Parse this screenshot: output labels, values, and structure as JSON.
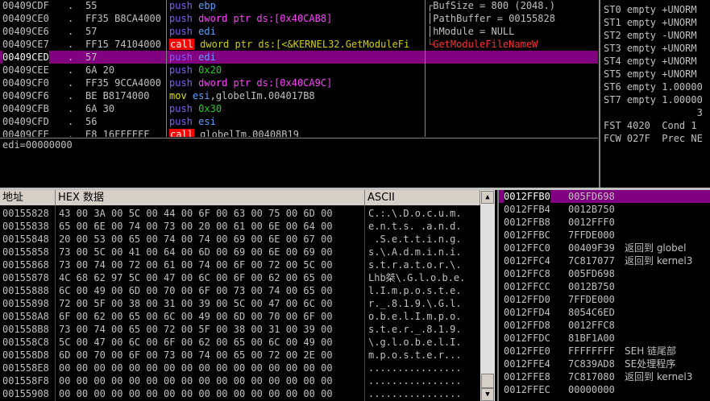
{
  "disasm": {
    "rows": [
      {
        "addr": "00409CDF",
        "dot": ".",
        "bytes": "55",
        "op": "push",
        "args": [
          {
            "t": "ebp",
            "c": "reg"
          }
        ],
        "selected": false
      },
      {
        "addr": "00409CE0",
        "dot": ".",
        "bytes": "FF35 B8CA4000",
        "op": "push",
        "args": [
          {
            "t": "dword ptr ds:[0x40CAB8]",
            "c": "mem"
          }
        ],
        "selected": false
      },
      {
        "addr": "00409CE6",
        "dot": ".",
        "bytes": "57",
        "op": "push",
        "args": [
          {
            "t": "edi",
            "c": "reg"
          }
        ],
        "selected": false
      },
      {
        "addr": "00409CE7",
        "dot": ".",
        "bytes": "FF15 74104000",
        "op": "call",
        "args": [
          {
            "t": "dword ptr ds:[<&KERNEL32.GetModuleFi",
            "c": "callname"
          }
        ],
        "selected": false
      },
      {
        "addr": "00409CED",
        "dot": ".",
        "bytes": "57",
        "op": "push",
        "args": [
          {
            "t": "edi",
            "c": "reg"
          }
        ],
        "selected": true
      },
      {
        "addr": "00409CEE",
        "dot": ".",
        "bytes": "6A 20",
        "op": "push",
        "args": [
          {
            "t": "0x20",
            "c": "num"
          }
        ],
        "selected": false
      },
      {
        "addr": "00409CF0",
        "dot": ".",
        "bytes": "FF35 9CCA4000",
        "op": "push",
        "args": [
          {
            "t": "dword ptr ds:[0x40CA9C]",
            "c": "mem"
          }
        ],
        "selected": false
      },
      {
        "addr": "00409CF6",
        "dot": ".",
        "bytes": "BE B8174000",
        "op": "mov",
        "args": [
          {
            "t": "esi",
            "c": "reg"
          },
          {
            "t": ",globelIm.004017B8",
            "c": "plain"
          }
        ],
        "selected": false
      },
      {
        "addr": "00409CFB",
        "dot": ".",
        "bytes": "6A 30",
        "op": "push",
        "args": [
          {
            "t": "0x30",
            "c": "num"
          }
        ],
        "selected": false
      },
      {
        "addr": "00409CFD",
        "dot": ".",
        "bytes": "56",
        "op": "push",
        "args": [
          {
            "t": "esi",
            "c": "reg"
          }
        ],
        "selected": false
      },
      {
        "addr": "00409CFE",
        "dot": ".",
        "bytes": "E8 16FFFFFF",
        "op": "call",
        "args": [
          {
            "t": "globelIm.00408B19",
            "c": "plain"
          }
        ],
        "selected": false
      }
    ],
    "comments": [
      {
        "text": "┌BufSize = 800 (2048.)",
        "c": "plain"
      },
      {
        "text": "│PathBuffer = 00155828",
        "c": "plain"
      },
      {
        "text": "│hModule = NULL",
        "c": "plain"
      },
      {
        "text": "└GetModuleFileNameW",
        "c": "red"
      }
    ]
  },
  "info": {
    "text": "edi=00000000"
  },
  "registers": {
    "rows": [
      "ST0 empty +UNORM",
      "ST1 empty +UNORM",
      "ST2 empty -UNORM",
      "ST3 empty +UNORM",
      "ST4 empty +UNORM",
      "ST5 empty +UNORM",
      "ST6 empty 1.00000",
      "ST7 empty 1.00000",
      "                3",
      "FST 4020  Cond 1",
      "FCW 027F  Prec NE"
    ]
  },
  "dump": {
    "header": {
      "addr": "地址",
      "hex": "HEX 数据",
      "ascii": "ASCII"
    },
    "rows": [
      {
        "addr": "00155828",
        "hex": "43 00 3A 00 5C 00 44 00 6F 00 63 00 75 00 6D 00",
        "ascii": "C.:.\\.D.o.c.u.m."
      },
      {
        "addr": "00155838",
        "hex": "65 00 6E 00 74 00 73 00 20 00 61 00 6E 00 64 00",
        "ascii": "e.n.t.s. .a.n.d."
      },
      {
        "addr": "00155848",
        "hex": "20 00 53 00 65 00 74 00 74 00 69 00 6E 00 67 00",
        "ascii": " .S.e.t.t.i.n.g."
      },
      {
        "addr": "00155858",
        "hex": "73 00 5C 00 41 00 64 00 6D 00 69 00 6E 00 69 00",
        "ascii": "s.\\.A.d.m.i.n.i."
      },
      {
        "addr": "00155868",
        "hex": "73 00 74 00 72 00 61 00 74 00 6F 00 72 00 5C 00",
        "ascii": "s.t.r.a.t.o.r.\\."
      },
      {
        "addr": "00155878",
        "hex": "4C 68 62 97 5C 00 47 00 6C 00 6F 00 62 00 65 00",
        "ascii": "Lhb桀\\.G.l.o.b.e."
      },
      {
        "addr": "00155888",
        "hex": "6C 00 49 00 6D 00 70 00 6F 00 73 00 74 00 65 00",
        "ascii": "l.I.m.p.o.s.t.e."
      },
      {
        "addr": "00155898",
        "hex": "72 00 5F 00 38 00 31 00 39 00 5C 00 47 00 6C 00",
        "ascii": "r._.8.1.9.\\.G.l."
      },
      {
        "addr": "001558A8",
        "hex": "6F 00 62 00 65 00 6C 00 49 00 6D 00 70 00 6F 00",
        "ascii": "o.b.e.l.I.m.p.o."
      },
      {
        "addr": "001558B8",
        "hex": "73 00 74 00 65 00 72 00 5F 00 38 00 31 00 39 00",
        "ascii": "s.t.e.r._.8.1.9."
      },
      {
        "addr": "001558C8",
        "hex": "5C 00 47 00 6C 00 6F 00 62 00 65 00 6C 00 49 00",
        "ascii": "\\.g.l.o.b.e.l.I."
      },
      {
        "addr": "001558D8",
        "hex": "6D 00 70 00 6F 00 73 00 74 00 65 00 72 00 2E 00",
        "ascii": "m.p.o.s.t.e.r..."
      },
      {
        "addr": "001558E8",
        "hex": "00 00 00 00 00 00 00 00 00 00 00 00 00 00 00 00",
        "ascii": "................"
      },
      {
        "addr": "001558F8",
        "hex": "00 00 00 00 00 00 00 00 00 00 00 00 00 00 00 00",
        "ascii": "................"
      },
      {
        "addr": "00155908",
        "hex": "00 00 00 00 00 00 00 00 00 00 00 00 00 00 00 00",
        "ascii": "................"
      }
    ]
  },
  "stack": {
    "rows": [
      {
        "addr": "0012FFB0",
        "val": "005FD698",
        "comment": "",
        "selected": true
      },
      {
        "addr": "0012FFB4",
        "val": "0012B750",
        "comment": "",
        "selected": false
      },
      {
        "addr": "0012FFB8",
        "val": "0012FFF0",
        "comment": "",
        "selected": false
      },
      {
        "addr": "0012FFBC",
        "val": "7FFDE000",
        "comment": "",
        "selected": false
      },
      {
        "addr": "0012FFC0",
        "val": "00409F39",
        "comment": "返回到 globel",
        "selected": false
      },
      {
        "addr": "0012FFC4",
        "val": "7C817077",
        "comment": "返回到 kernel3",
        "selected": false
      },
      {
        "addr": "0012FFC8",
        "val": "005FD698",
        "comment": "",
        "selected": false
      },
      {
        "addr": "0012FFCC",
        "val": "0012B750",
        "comment": "",
        "selected": false
      },
      {
        "addr": "0012FFD0",
        "val": "7FFDE000",
        "comment": "",
        "selected": false
      },
      {
        "addr": "0012FFD4",
        "val": "8054C6ED",
        "comment": "",
        "selected": false
      },
      {
        "addr": "0012FFD8",
        "val": "0012FFC8",
        "comment": "",
        "selected": false
      },
      {
        "addr": "0012FFDC",
        "val": "81BF1A00",
        "comment": "",
        "selected": false
      },
      {
        "addr": "0012FFE0",
        "val": "FFFFFFFF",
        "comment": "SEH 链尾部",
        "selected": false
      },
      {
        "addr": "0012FFE4",
        "val": "7C839AD8",
        "comment": "SE处理程序",
        "selected": false
      },
      {
        "addr": "0012FFE8",
        "val": "7C817080",
        "comment": "返回到 kernel3",
        "selected": false
      },
      {
        "addr": "0012FFEC",
        "val": "00000000",
        "comment": "",
        "selected": false
      }
    ]
  }
}
